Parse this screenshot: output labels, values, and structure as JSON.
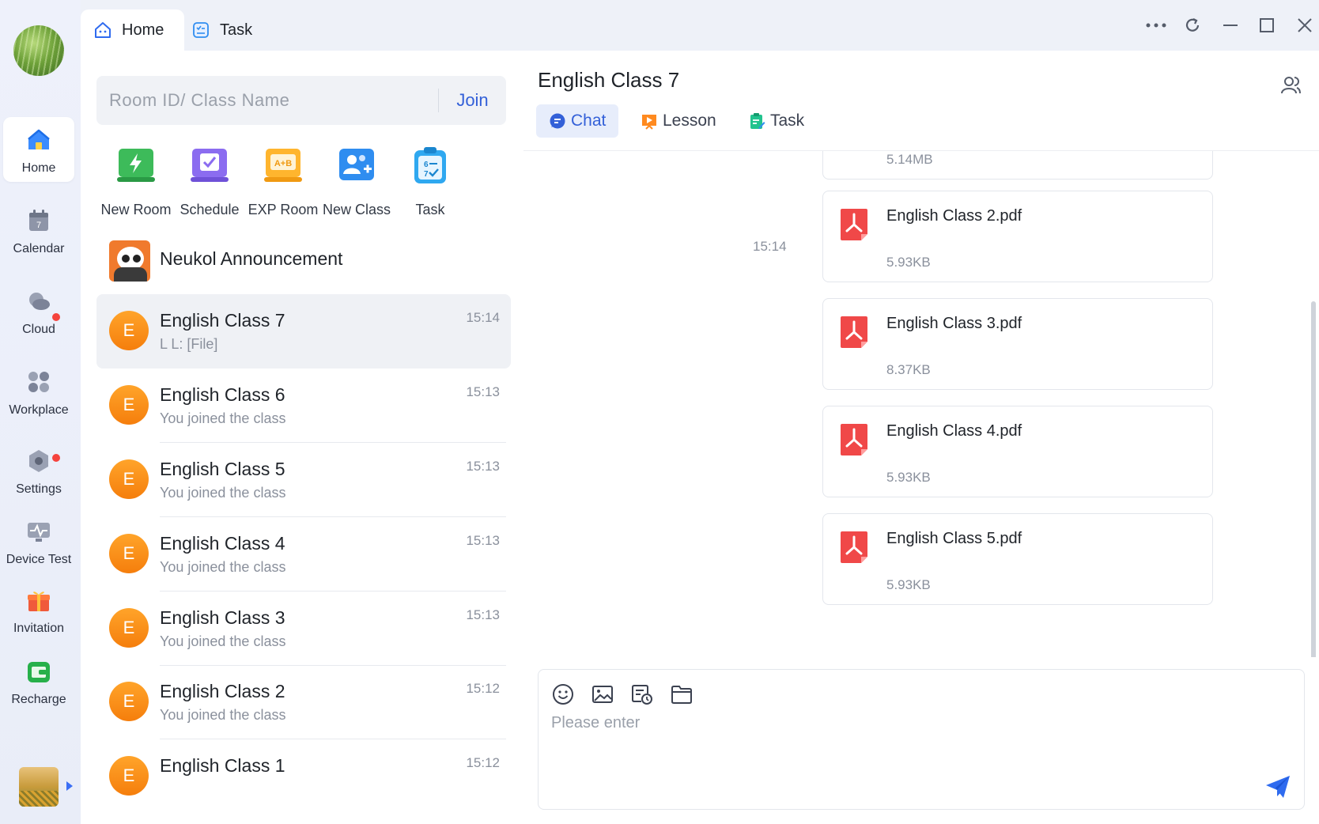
{
  "rail": {
    "items": [
      {
        "label": "Home",
        "icon": "home-icon"
      },
      {
        "label": "Calendar",
        "icon": "calendar-icon",
        "day": "7"
      },
      {
        "label": "Cloud",
        "icon": "cloud-icon"
      },
      {
        "label": "Workplace",
        "icon": "workplace-icon"
      },
      {
        "label": "Settings",
        "icon": "settings-icon"
      },
      {
        "label": "Device Test",
        "icon": "device-test-icon"
      },
      {
        "label": "Invitation",
        "icon": "gift-icon"
      },
      {
        "label": "Recharge",
        "icon": "wallet-icon"
      }
    ]
  },
  "tabs": [
    {
      "label": "Home",
      "icon": "home-tab-icon"
    },
    {
      "label": "Task",
      "icon": "task-tab-icon"
    }
  ],
  "search": {
    "placeholder": "Room ID/ Class Name",
    "join_label": "Join"
  },
  "quick_actions": [
    {
      "label": "New Room",
      "icon": "new-room-icon"
    },
    {
      "label": "Schedule",
      "icon": "schedule-icon"
    },
    {
      "label": "EXP Room",
      "icon": "exp-room-icon",
      "badge": "A+B"
    },
    {
      "label": "New Class",
      "icon": "new-class-icon"
    },
    {
      "label": "Task",
      "icon": "task-icon",
      "badge": "6-2 7"
    }
  ],
  "announcement": {
    "name": "Neukol Announcement"
  },
  "conversations": [
    {
      "initial": "E",
      "name": "English Class 7",
      "sub": "L L: [File]",
      "time": "15:14"
    },
    {
      "initial": "E",
      "name": "English Class 6",
      "sub": "You joined the class",
      "time": "15:13"
    },
    {
      "initial": "E",
      "name": "English Class 5",
      "sub": "You joined the class",
      "time": "15:13"
    },
    {
      "initial": "E",
      "name": "English Class 4",
      "sub": "You joined the class",
      "time": "15:13"
    },
    {
      "initial": "E",
      "name": "English Class 3",
      "sub": "You joined the class",
      "time": "15:13"
    },
    {
      "initial": "E",
      "name": "English Class 2",
      "sub": "You joined the class",
      "time": "15:12"
    },
    {
      "initial": "E",
      "name": "English Class 1",
      "sub": "",
      "time": "15:12"
    }
  ],
  "chat": {
    "title": "English Class 7",
    "tabs": [
      {
        "label": "Chat",
        "icon": "chat-icon"
      },
      {
        "label": "Lesson",
        "icon": "lesson-icon"
      },
      {
        "label": "Task",
        "icon": "task-clipboard-icon"
      }
    ],
    "message_time": "15:14",
    "files": [
      {
        "name": "",
        "size": "5.14MB"
      },
      {
        "name": "English Class 2.pdf",
        "size": "5.93KB"
      },
      {
        "name": "English Class 3.pdf",
        "size": "8.37KB"
      },
      {
        "name": "English Class 4.pdf",
        "size": "5.93KB"
      },
      {
        "name": "English Class 5.pdf",
        "size": "5.93KB"
      }
    ],
    "composer": {
      "placeholder": "Please enter",
      "tools": [
        "emoji-icon",
        "image-icon",
        "screenshot-icon",
        "folder-icon"
      ]
    }
  },
  "colors": {
    "accent": "#3360d8",
    "avatar_orange": "#f57e0c",
    "pdf_red": "#f04848",
    "badge_red": "#f5433d"
  }
}
